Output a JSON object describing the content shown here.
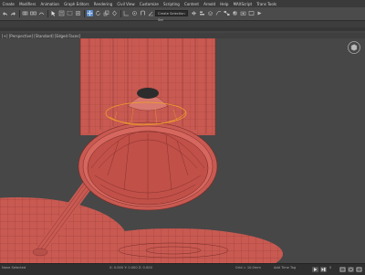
{
  "menubar": {
    "items": [
      "Create",
      "Modifiers",
      "Animation",
      "Graph Editors",
      "Rendering",
      "Civil View",
      "Customize",
      "Scripting",
      "Content",
      "Arnold",
      "Help",
      "MAXScript",
      "Trans Tools"
    ]
  },
  "toolbar": {
    "selection_set_placeholder": "Create Selection Set"
  },
  "viewport": {
    "label": "[+] [Perspective] [Standard] [Edged Faces]"
  },
  "status": {
    "left_text": "None Selected",
    "coords": "X: 0.000  Y: 0.000  Z: 0.000",
    "grid": "Grid = 10.0mm",
    "time_tag": "Add Time Tag",
    "frame": "0"
  },
  "colors": {
    "mesh_fill": "#c85a52",
    "mesh_wire": "#7a2a26",
    "selection_highlight": "#f0a02a",
    "viewport_bg": "#474747"
  }
}
